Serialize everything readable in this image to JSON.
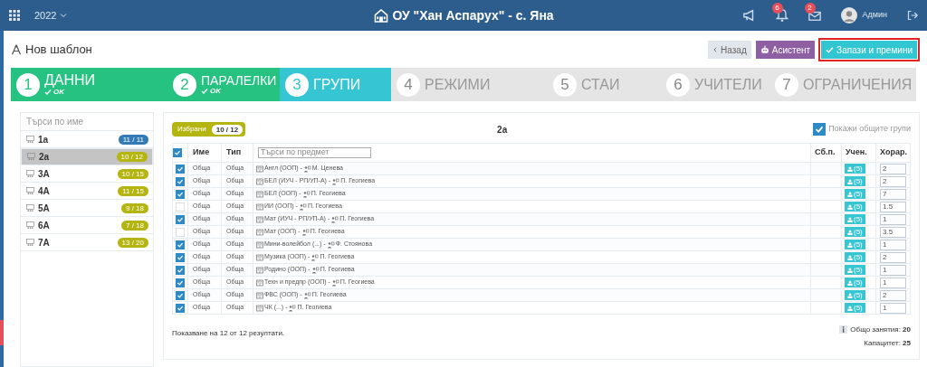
{
  "header": {
    "year": "2022",
    "title": "ОУ \"Хан Аспарух\" - с. Яна",
    "notifications": "6",
    "messages": "2",
    "user": "Админ"
  },
  "page_title": "Нов шаблон",
  "actions": {
    "back": "Назад",
    "assistant": "Асистент",
    "save": "Запази и премини"
  },
  "steps": [
    {
      "number": "1",
      "label": "ДАННИ",
      "note": "OK",
      "completed": true,
      "selected": false
    },
    {
      "number": "2",
      "label": "ПАРАЛЕЛКИ",
      "note": "OK",
      "completed": true,
      "selected": false
    },
    {
      "number": "3",
      "label": "ГРУПИ",
      "completed": false,
      "selected": true
    },
    {
      "number": "4",
      "label": "РЕЖИМИ",
      "completed": false,
      "selected": false
    },
    {
      "number": "5",
      "label": "СТАИ",
      "completed": false,
      "selected": false
    },
    {
      "number": "6",
      "label": "УЧИТЕЛИ",
      "completed": false,
      "selected": false
    },
    {
      "number": "7",
      "label": "ОГРАНИЧЕНИЯ",
      "completed": false,
      "selected": false
    }
  ],
  "classes": {
    "placeholder": "Търси по име",
    "items": [
      {
        "name": "1а",
        "count": "11 / 11",
        "color": "#337ab7",
        "selected": false
      },
      {
        "name": "2а",
        "count": "10 / 12",
        "color": "#b5b512",
        "selected": true
      },
      {
        "name": "3А",
        "count": "10 / 15",
        "color": "#b5b512",
        "selected": false
      },
      {
        "name": "4А",
        "count": "11 / 15",
        "color": "#b5b512",
        "selected": false
      },
      {
        "name": "5А",
        "count": "9 / 18",
        "color": "#b5b512",
        "selected": false
      },
      {
        "name": "6А",
        "count": "7 / 18",
        "color": "#b5b512",
        "selected": false
      },
      {
        "name": "7А",
        "count": "13 / 20",
        "color": "#b5b512",
        "selected": false
      }
    ]
  },
  "groups": {
    "selected_label": "Избрани",
    "selected_count": "10 / 12",
    "heading": "2а",
    "show_common": {
      "label": "Покажи общите групи",
      "checked": true
    },
    "table": {
      "all_checked": true,
      "columns": [
        "Име",
        "Тип",
        "Сб.п.",
        "Учен.",
        "Хорар."
      ],
      "subject_placeholder": "Търси по предмет",
      "rows": [
        {
          "checked": true,
          "name": "Обща",
          "type": "Обща",
          "subject": "Англ (ООП) -",
          "teacher": "М. Ценева",
          "students": "(5)",
          "hours": "2"
        },
        {
          "checked": true,
          "name": "Обща",
          "type": "Обща",
          "subject": "БЕЛ (ИУЧ - РП/УП-А) -",
          "teacher": "П. Геогиева",
          "students": "(5)",
          "hours": "2"
        },
        {
          "checked": true,
          "name": "Обща",
          "type": "Обща",
          "subject": "БЕЛ (ООП) -",
          "teacher": "П. Геогиева",
          "students": "(5)",
          "hours": "7"
        },
        {
          "checked": false,
          "name": "Обща",
          "type": "Обща",
          "subject": "ИИ (ООП) -",
          "teacher": "П. Геогиева",
          "students": "(5)",
          "hours": "1.5"
        },
        {
          "checked": true,
          "name": "Обща",
          "type": "Обща",
          "subject": "Мат (ИУЧ - РП/УП-А) -",
          "teacher": "П. Геогиева",
          "students": "(5)",
          "hours": "1"
        },
        {
          "checked": false,
          "name": "Обща",
          "type": "Обща",
          "subject": "Мат (ООП) -",
          "teacher": "П. Геогиева",
          "students": "(5)",
          "hours": "3.5"
        },
        {
          "checked": true,
          "name": "Обща",
          "type": "Обща",
          "subject": "Мини-волейбол (...) -",
          "teacher": "Ф. Стоянова",
          "students": "(5)",
          "hours": "1"
        },
        {
          "checked": true,
          "name": "Обща",
          "type": "Обща",
          "subject": "Музика (ООП) -",
          "teacher": "П. Геогиева",
          "students": "(5)",
          "hours": "2"
        },
        {
          "checked": true,
          "name": "Обща",
          "type": "Обща",
          "subject": "Родино (ООП) -",
          "teacher": "П. Геогиева",
          "students": "(5)",
          "hours": "1"
        },
        {
          "checked": true,
          "name": "Обща",
          "type": "Обща",
          "subject": "Техн и предпр (ООП) -",
          "teacher": "П. Геогиева",
          "students": "(5)",
          "hours": "1"
        },
        {
          "checked": true,
          "name": "Обща",
          "type": "Обща",
          "subject": "ФВС (ООП) -",
          "teacher": "П. Геогиева",
          "students": "(5)",
          "hours": "2"
        },
        {
          "checked": true,
          "name": "Обща",
          "type": "Обща",
          "subject": "ЧК (...) -",
          "teacher": "П. Геогиева",
          "students": "(5)",
          "hours": "1"
        }
      ]
    },
    "footer": "Показване на 12 от 12 резултати.",
    "total_label": "Общо занятия:",
    "total": "20",
    "capacity_label": "Капацитет:",
    "capacity": "25"
  }
}
